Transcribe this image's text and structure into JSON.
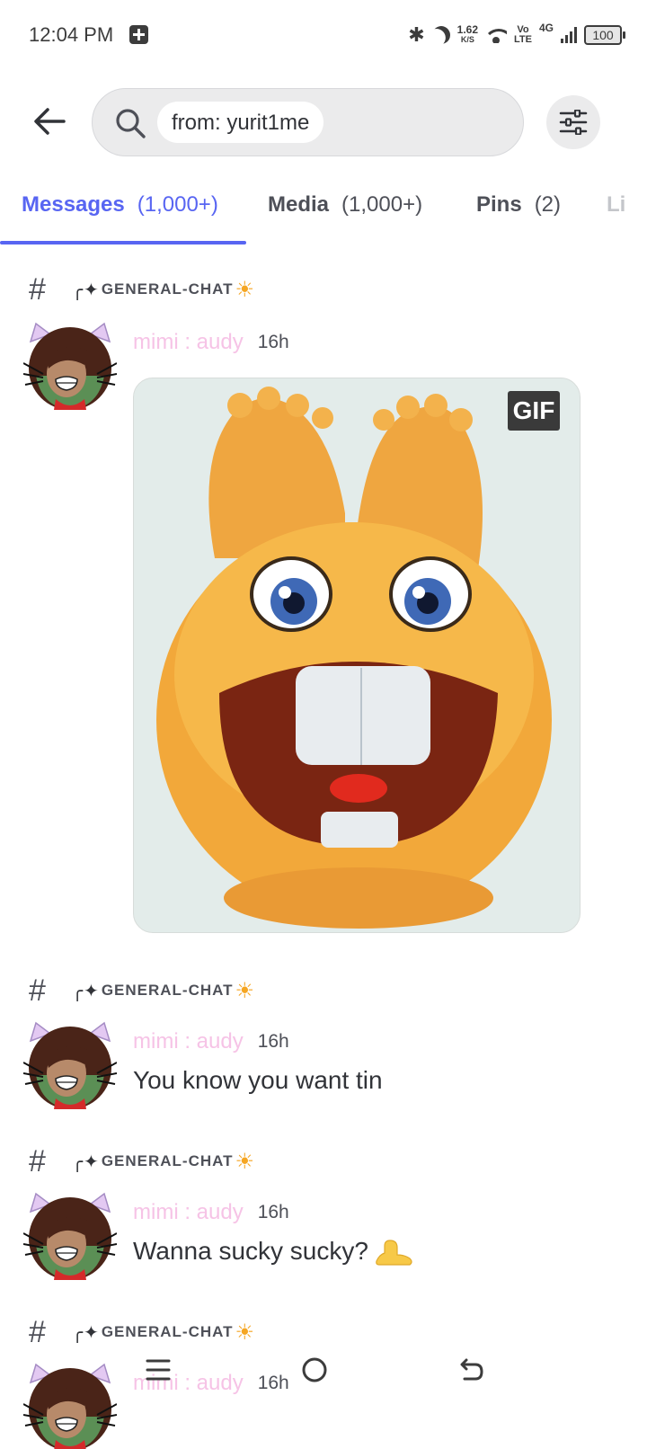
{
  "status_bar": {
    "time": "12:04 PM",
    "speed_value": "1.62",
    "speed_unit": "K/S",
    "volte_top": "Vo",
    "volte_bottom": "LTE",
    "network": "4G",
    "battery": "100",
    "icons": [
      "notification-icon",
      "bluetooth-icon",
      "moon-icon",
      "wifi-icon",
      "signal-icon",
      "battery-icon"
    ]
  },
  "header": {
    "back_icon": "arrow-left-icon",
    "search_icon": "search-icon",
    "search_query": "from: yurit1me",
    "filter_icon": "sliders-icon"
  },
  "tabs": [
    {
      "label": "Messages",
      "count": "(1,000+)",
      "active": true
    },
    {
      "label": "Media",
      "count": "(1,000+)",
      "active": false
    },
    {
      "label": "Pins",
      "count": "(2)",
      "active": false
    },
    {
      "label": "Li",
      "count": "",
      "active": false
    }
  ],
  "results": [
    {
      "channel": "GENERAL-CHAT",
      "author": "mimi : audy",
      "time": "16h",
      "attachment": "GIF",
      "text": ""
    },
    {
      "channel": "GENERAL-CHAT",
      "author": "mimi : audy",
      "time": "16h",
      "text": "You know you want tin"
    },
    {
      "channel": "GENERAL-CHAT",
      "author": "mimi : audy",
      "time": "16h",
      "text": "Wanna sucky sucky?"
    },
    {
      "channel": "GENERAL-CHAT",
      "author": "mimi : audy",
      "time": "16h",
      "text": ""
    }
  ],
  "channel_decor": {
    "prefix": "╭✦",
    "suffix": "☀"
  },
  "colors": {
    "accent": "#5865f2",
    "author": "#f6c3e6",
    "text": "#313338",
    "muted": "#4e5058",
    "search_bg": "#ebebec"
  },
  "nav": {
    "icons": [
      "menu-icon",
      "home-circle-icon",
      "back-return-icon"
    ]
  }
}
